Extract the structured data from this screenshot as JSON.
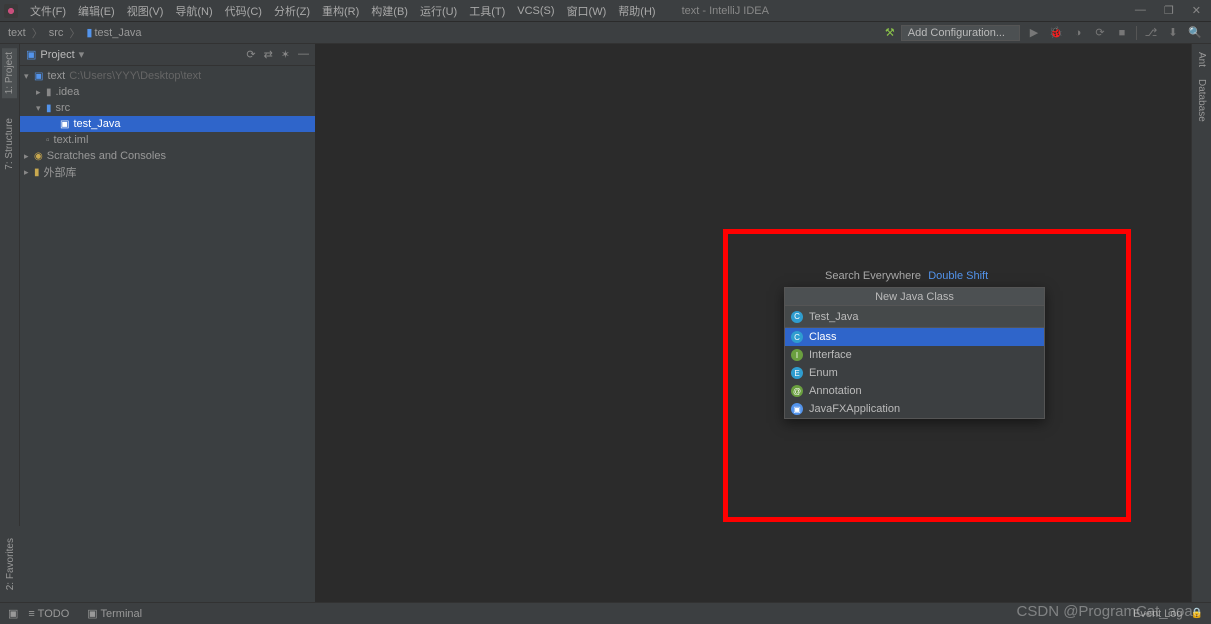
{
  "titlebar": {
    "menus": [
      "文件(F)",
      "编辑(E)",
      "视图(V)",
      "导航(N)",
      "代码(C)",
      "分析(Z)",
      "重构(R)",
      "构建(B)",
      "运行(U)",
      "工具(T)",
      "VCS(S)",
      "窗口(W)",
      "帮助(H)"
    ],
    "title": "text - IntelliJ IDEA",
    "win_min": "—",
    "win_max": "❐",
    "win_close": "✕"
  },
  "breadcrumbs": {
    "items": [
      "text",
      "src",
      "test_Java"
    ],
    "folder_glyph": "▮"
  },
  "toolbar": {
    "add_config": "Add Configuration...",
    "run_glyph": "▶",
    "debug_glyph": "⬤",
    "stop_glyph": "■",
    "search_glyph": "🔍"
  },
  "sidebar": {
    "view_label": "Project",
    "tools_glyphs": [
      "⟳",
      "⇄",
      "✶",
      "—"
    ]
  },
  "tree": {
    "root": {
      "name": "text",
      "path": "C:\\Users\\YYY\\Desktop\\text"
    },
    "idea": ".idea",
    "src": "src",
    "test_java": "test_Java",
    "text_iml": "text.iml",
    "scratches": "Scratches and Consoles",
    "ext_libs": "外部库"
  },
  "left_tabs": {
    "project": "1: Project",
    "structure": "7: Structure",
    "favorites": "2: Favorites"
  },
  "right_tabs": {
    "ant": "Ant",
    "database": "Database"
  },
  "hint": {
    "label": "Search Everywhere",
    "shortcut": "Double Shift"
  },
  "popup": {
    "title": "New Java Class",
    "input_value": "Test_Java",
    "options": [
      {
        "label": "Class",
        "icon": "C",
        "color": "blue",
        "selected": true
      },
      {
        "label": "Interface",
        "icon": "I",
        "color": "green",
        "selected": false
      },
      {
        "label": "Enum",
        "icon": "E",
        "color": "blue",
        "selected": false
      },
      {
        "label": "Annotation",
        "icon": "@",
        "color": "green",
        "selected": false
      },
      {
        "label": "JavaFXApplication",
        "icon": "▣",
        "color": "file",
        "selected": false
      }
    ]
  },
  "statusbar": {
    "todo": "≡ TODO",
    "terminal": "▣ Terminal",
    "event_log": "Event Log"
  },
  "watermark": "CSDN @ProgramCat_aoao"
}
